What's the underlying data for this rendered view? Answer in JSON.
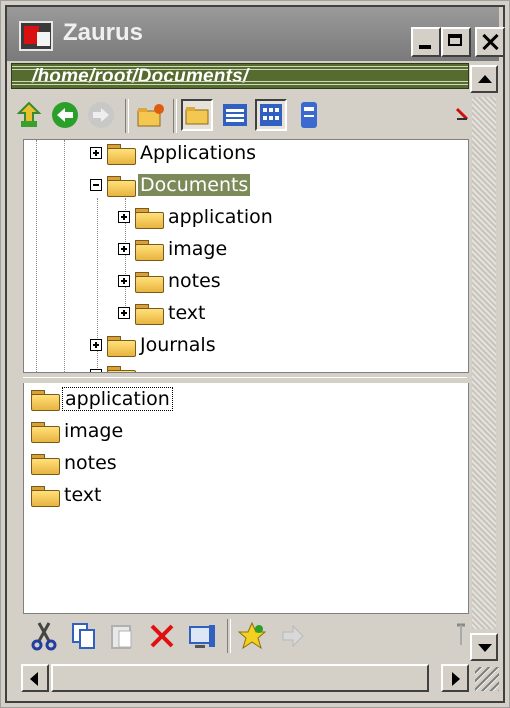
{
  "window": {
    "title": "Zaurus"
  },
  "path": {
    "text": "/home/root/Documents/"
  },
  "toolbar": {
    "items": [
      "up-folder-icon",
      "back-icon",
      "forward-icon",
      "new-folder-icon",
      "tree-view-icon",
      "list-view-icon",
      "detail-view-icon",
      "storage-icon",
      "close-panel-icon"
    ]
  },
  "tree": {
    "items": [
      {
        "label": "Applications",
        "expanded": false,
        "selected": false
      },
      {
        "label": "Documents",
        "expanded": true,
        "selected": true
      },
      {
        "label": "application",
        "expanded": false,
        "selected": false
      },
      {
        "label": "image",
        "expanded": false,
        "selected": false
      },
      {
        "label": "notes",
        "expanded": false,
        "selected": false
      },
      {
        "label": "text",
        "expanded": false,
        "selected": false
      },
      {
        "label": "Journals",
        "expanded": false,
        "selected": false
      }
    ]
  },
  "list": {
    "items": [
      {
        "label": "application"
      },
      {
        "label": "image"
      },
      {
        "label": "notes"
      },
      {
        "label": "text"
      }
    ]
  },
  "bottom_toolbar": {
    "items": [
      "cut-icon",
      "copy-icon",
      "paste-icon",
      "delete-icon",
      "properties-icon",
      "favorite-icon",
      "forward-disabled-icon"
    ]
  },
  "colors": {
    "selection": "#7c8a5a",
    "pathbar": "#556b2f",
    "titlebar": "#8a8a8a"
  }
}
